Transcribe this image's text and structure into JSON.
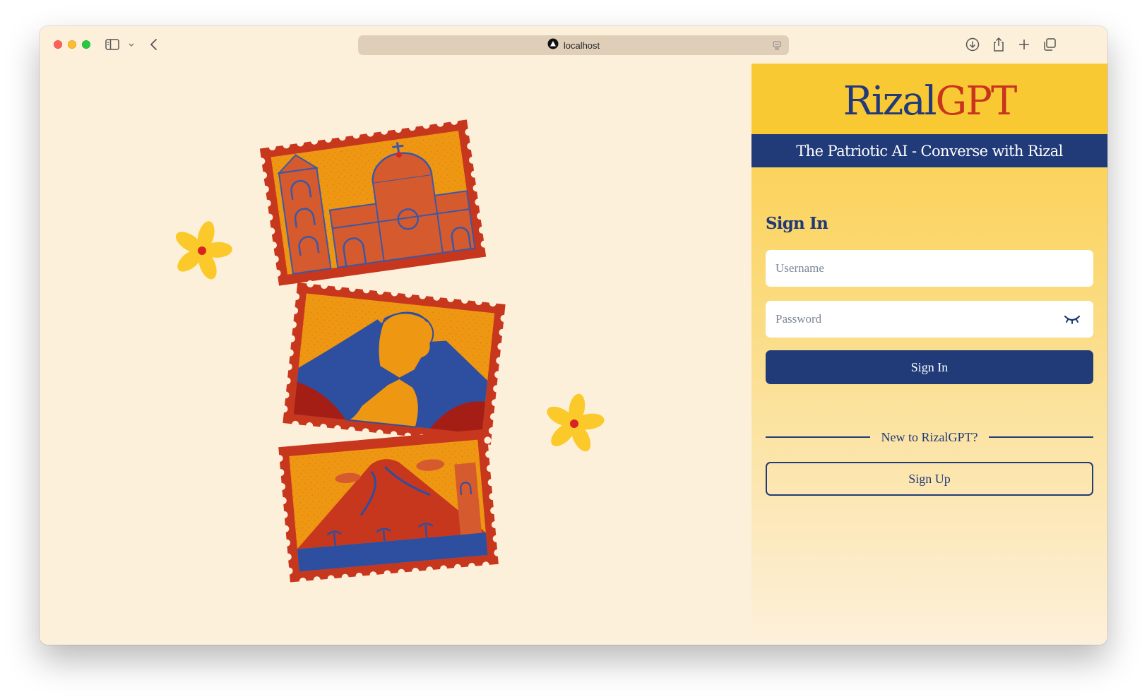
{
  "browser": {
    "url": "localhost",
    "icons": [
      "sidebar-toggle-icon",
      "chevron-down-icon",
      "back-icon",
      "site-logo-icon",
      "reader-icon",
      "download-icon",
      "share-icon",
      "new-tab-icon",
      "tab-overview-icon"
    ]
  },
  "brand": {
    "name_part1": "Rizal",
    "name_part2": "GPT",
    "tagline": "The Patriotic AI - Converse with Rizal"
  },
  "signin": {
    "title": "Sign In",
    "username_placeholder": "Username",
    "password_placeholder": "Password",
    "submit_label": "Sign In"
  },
  "signup": {
    "prompt": "New to RizalGPT?",
    "button_label": "Sign Up"
  },
  "colors": {
    "navy": "#213a78",
    "red": "#c8341e",
    "yellow": "#f9c934",
    "cream": "#fdf0db",
    "stamp_orange": "#ee9712"
  }
}
